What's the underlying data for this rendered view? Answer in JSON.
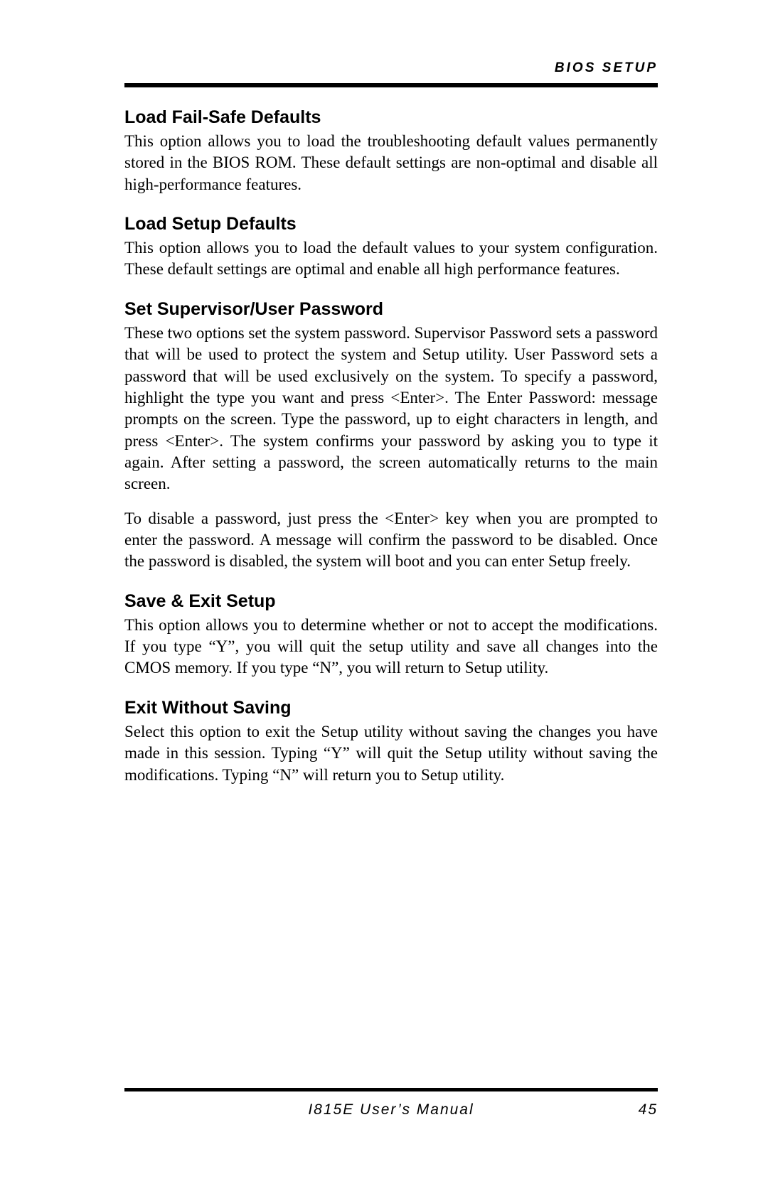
{
  "header": {
    "title": "BIOS SETUP"
  },
  "sections": {
    "s1": {
      "heading": "Load Fail-Safe Defaults",
      "body": "This option allows you to load the troubleshooting default values permanently stored in the BIOS ROM. These default settings are non-optimal and disable all high-performance features."
    },
    "s2": {
      "heading": "Load Setup Defaults",
      "body": "This option allows you to load the default values to your system configuration. These default settings are optimal and enable all high performance features."
    },
    "s3": {
      "heading": "Set Supervisor/User Password",
      "body1": "These two options set the system password. Supervisor Password sets a password that will be used to protect the system and Setup utility. User Password sets a password that will be used exclusively on the system. To specify a password, highlight the type you want and press <Enter>. The Enter Password: message prompts on the screen. Type the password, up to eight characters in length, and press <Enter>. The system confirms your password by asking you to type it again. After setting a password, the screen automatically returns to the main screen.",
      "body2": "To disable a password, just press the <Enter> key when you are prompted to enter the password. A message will confirm the password to be disabled. Once the password is disabled, the system will boot and you can enter Setup freely."
    },
    "s4": {
      "heading": "Save & Exit Setup",
      "body": "This option allows you to determine whether or not to accept the modifications. If you type “Y”, you will quit the setup utility and save all changes into the CMOS memory. If you type “N”, you will return to Setup utility."
    },
    "s5": {
      "heading": "Exit Without Saving",
      "body": "Select this option to exit the Setup utility without saving the changes you have made in this session. Typing “Y” will quit the Setup utility without saving the modifications. Typing “N” will return you to Setup utility."
    }
  },
  "footer": {
    "manual": "I815E User’s Manual",
    "page": "45"
  }
}
